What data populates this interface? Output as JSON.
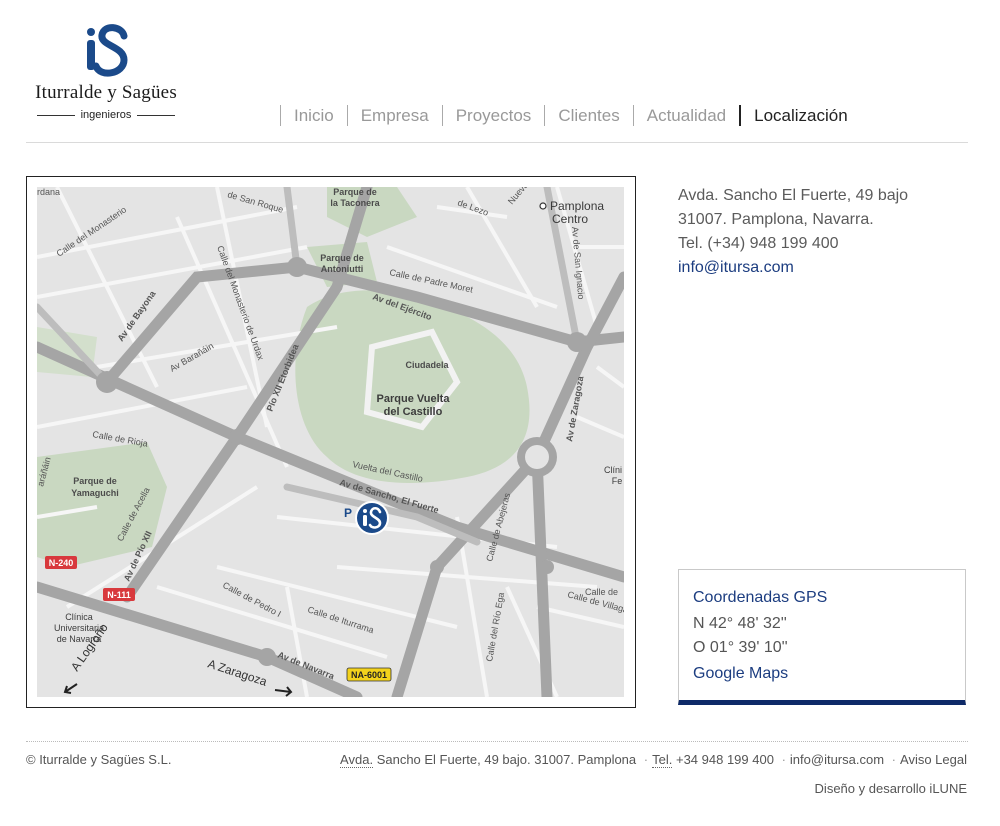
{
  "brand": {
    "name": "Iturralde y Sagües",
    "sub": "ingenieros",
    "color": "#1b4a8a"
  },
  "nav": {
    "items": [
      {
        "label": "Inicio"
      },
      {
        "label": "Empresa"
      },
      {
        "label": "Proyectos"
      },
      {
        "label": "Clientes"
      },
      {
        "label": "Actualidad"
      },
      {
        "label": "Localización"
      }
    ],
    "active": "Localización"
  },
  "map": {
    "labels": {
      "parque_taconera": [
        "Parque de",
        "la Taconera"
      ],
      "pamplona_centro": [
        "Pamplona",
        "Centro"
      ],
      "parque_antoniutti": [
        "Parque de",
        "Antoniutti"
      ],
      "ciudadela": "Ciudadela",
      "parque_vuelta": [
        "Parque Vuelta",
        "del Castillo"
      ],
      "parque_yamaguchi": [
        "Parque de",
        "Yamaguchi"
      ],
      "clinica": [
        "Clínica",
        "Universitaria",
        "de Navarra"
      ],
      "clinica_right": [
        "Clíni",
        "Fe"
      ],
      "av_bayona": "Av de Bayona",
      "av_ejercito": "Av del Ejército",
      "av_zaragoza": "Av de Zaragoza",
      "pio_xii": "Pío XII Etorbidea",
      "av_pio_xii": "Av de Pío XII",
      "av_sancho": "Av de Sancho, El Fuerte",
      "vuelta_castillo": "Vuelta del Castillo",
      "av_navarra": "Av de Navarra",
      "a_zaragoza": "A Zaragoza",
      "a_logrono": "A Logroño",
      "calle_rioja": "Calle de Rioja",
      "av_baranain": "Av Barañáin",
      "calle_monasterio_urdax": "Calle del Monasterio de Urdax",
      "calle_padre_moret": "Calle de Padre Moret",
      "calle_san_roque": "de San Roque",
      "calle_abejeras": "Calle de Abejeras",
      "calle_rio_ega": "Calle del Río Ega",
      "calle_iturrama": "Calle de Iturrama",
      "calle_pedro_i": "Calle de Pedro I",
      "calle_acella": "Calle de Acella",
      "av_san_ignacio": "Av de San Ignacio",
      "calle_villagar": "Calle de Villagar",
      "calle_lezo": "de Lezo",
      "calle_nueva": "Nueva",
      "calle_de": "Calle de",
      "ordana": "rdana",
      "arainain": "aráñáin",
      "calle_monasterio_lt": "Calle del Monasterio",
      "p_marker": "P"
    },
    "badges": {
      "n240": "N-240",
      "n111": "N-111",
      "na6001": "NA-6001"
    }
  },
  "address": {
    "line1": "Avda. Sancho El Fuerte, 49 bajo",
    "line2": "31007. Pamplona, Navarra.",
    "phone": "Tel. (+34) 948 199 400",
    "email": "info@itursa.com"
  },
  "gps": {
    "title": "Coordenadas GPS",
    "lat": "N 42° 48' 32''",
    "lon": "O 01° 39' 10''",
    "link": "Google Maps"
  },
  "footer": {
    "copyright": "© Iturralde y Sagües S.L.",
    "address_abbr": "Avda.",
    "address_rest": "Sancho El Fuerte, 49 bajo. 31007. Pamplona",
    "tel_abbr": "Tel.",
    "tel_rest": "+34 948 199 400",
    "email": "info@itursa.com",
    "legal": "Aviso Legal",
    "credit": "Diseño y desarrollo iLUNE"
  }
}
